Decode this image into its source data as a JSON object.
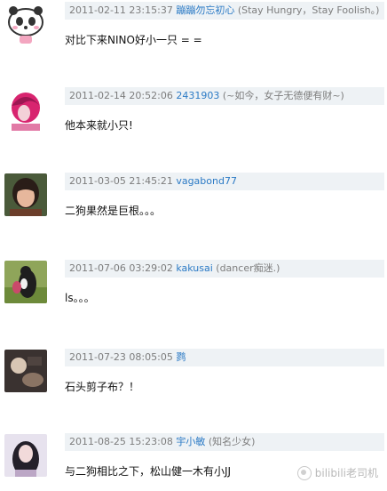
{
  "comments": [
    {
      "timestamp": "2011-02-11 23:15:37",
      "user": "蹦蹦勿忘初心",
      "tagline": "(Stay Hungry，Stay Foolish。)",
      "text": "对比下来NINO好小一只 = =",
      "avatar_icon": "panda-avatar-icon"
    },
    {
      "timestamp": "2011-02-14 20:52:06",
      "user": "2431903",
      "tagline": "(~如今，女子无德便有财~)",
      "text": "他本来就小只!",
      "avatar_icon": "pink-hair-avatar-icon"
    },
    {
      "timestamp": "2011-03-05 21:45:21",
      "user": "vagabond77",
      "tagline": "",
      "text": "二狗果然是巨根。。。",
      "avatar_icon": "girl-portrait-avatar-icon"
    },
    {
      "timestamp": "2011-07-06 03:29:02",
      "user": "kakusai",
      "tagline": "(dancer痴迷.)",
      "text": "ls。。。",
      "avatar_icon": "figure-grass-avatar-icon"
    },
    {
      "timestamp": "2011-07-23 08:05:05",
      "user": "鹨",
      "tagline": "",
      "text": "石头剪子布？！",
      "avatar_icon": "dark-photo-avatar-icon"
    },
    {
      "timestamp": "2011-08-25 15:23:08",
      "user": "宇小敏",
      "tagline": "(知名少女)",
      "text": "与二狗相比之下，松山健一木有小JJ",
      "avatar_icon": "long-hair-girl-avatar-icon"
    }
  ],
  "watermark": "bilibili老司机",
  "colors": {
    "meta_bg": "#eef2f5",
    "link": "#2b7ac5",
    "meta_text": "#7d7d7d"
  }
}
